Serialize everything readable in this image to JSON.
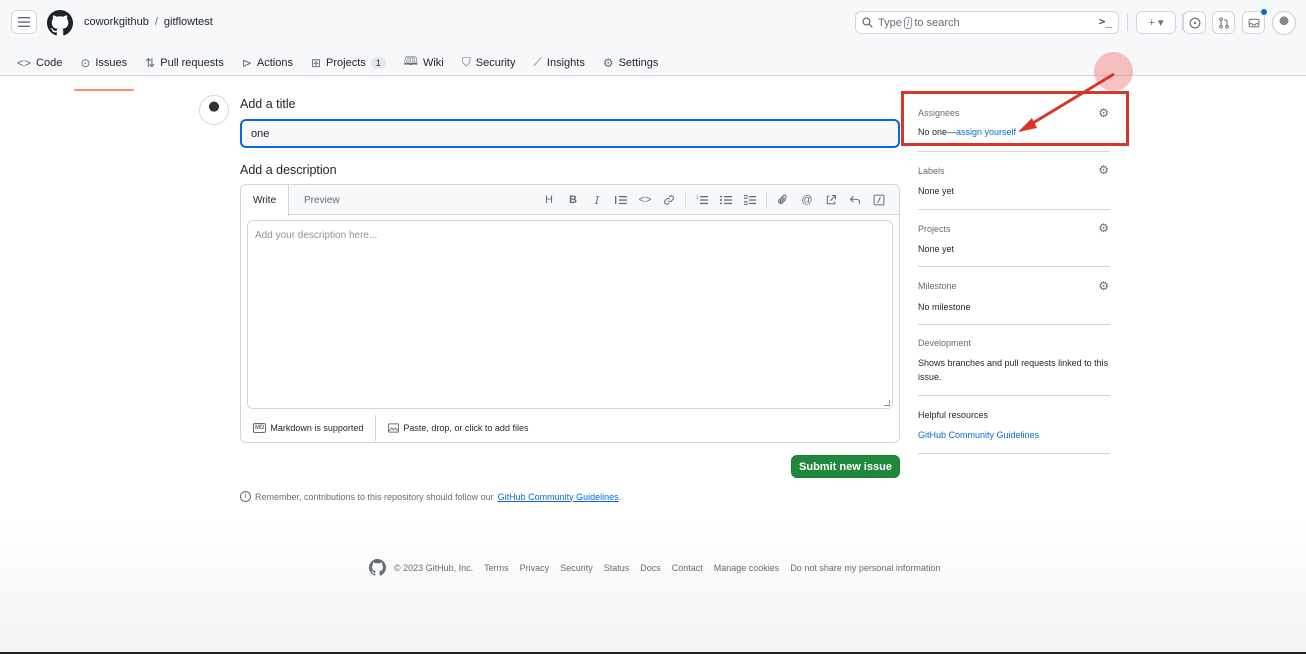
{
  "header": {
    "owner": "coworkgithub",
    "separator": "/",
    "repo": "gitflowtest",
    "search": {
      "prefix": "Type",
      "slash": "/",
      "suffix": "to search",
      "terminal": ">_"
    },
    "create_label": "+ ▾",
    "notification_dot_color": "#0969da"
  },
  "tabs": [
    {
      "label": "Code",
      "icon": "code-icon"
    },
    {
      "label": "Issues",
      "icon": "issue-opened-icon",
      "active": true
    },
    {
      "label": "Pull requests",
      "icon": "git-pull-request-icon"
    },
    {
      "label": "Actions",
      "icon": "play-icon"
    },
    {
      "label": "Projects",
      "icon": "table-icon",
      "count": "1"
    },
    {
      "label": "Wiki",
      "icon": "book-icon"
    },
    {
      "label": "Security",
      "icon": "shield-icon"
    },
    {
      "label": "Insights",
      "icon": "graph-icon"
    },
    {
      "label": "Settings",
      "icon": "gear-icon"
    }
  ],
  "form": {
    "title_label": "Add a title",
    "title_value": "one",
    "description_label": "Add a description",
    "write_tab": "Write",
    "preview_tab": "Preview",
    "description_placeholder": "Add your description here...",
    "markdown_note": "Markdown is supported",
    "markdown_badge": "MD",
    "files_note": "Paste, drop, or click to add files",
    "submit_label": "Submit new issue",
    "remember_text": "Remember, contributions to this repository should follow our",
    "remember_link": "GitHub Community Guidelines",
    "remember_end": "."
  },
  "toolbar": [
    "H",
    "B",
    "I"
  ],
  "sidebar": {
    "assignees": {
      "title": "Assignees",
      "value_prefix": "No one—",
      "value_link": "assign yourself"
    },
    "labels": {
      "title": "Labels",
      "value": "None yet"
    },
    "projects": {
      "title": "Projects",
      "value": "None yet"
    },
    "milestone": {
      "title": "Milestone",
      "value": "No milestone"
    },
    "development": {
      "title": "Development",
      "value": "Shows branches and pull requests linked to this issue."
    },
    "helpful": {
      "title": "Helpful resources",
      "link": "GitHub Community Guidelines"
    }
  },
  "annotation": {
    "box_color": "#d9362b",
    "arrow_color": "#d9362b"
  },
  "footer": {
    "copyright": "© 2023 GitHub, Inc.",
    "links": [
      "Terms",
      "Privacy",
      "Security",
      "Status",
      "Docs",
      "Contact",
      "Manage cookies",
      "Do not share my personal information"
    ]
  }
}
